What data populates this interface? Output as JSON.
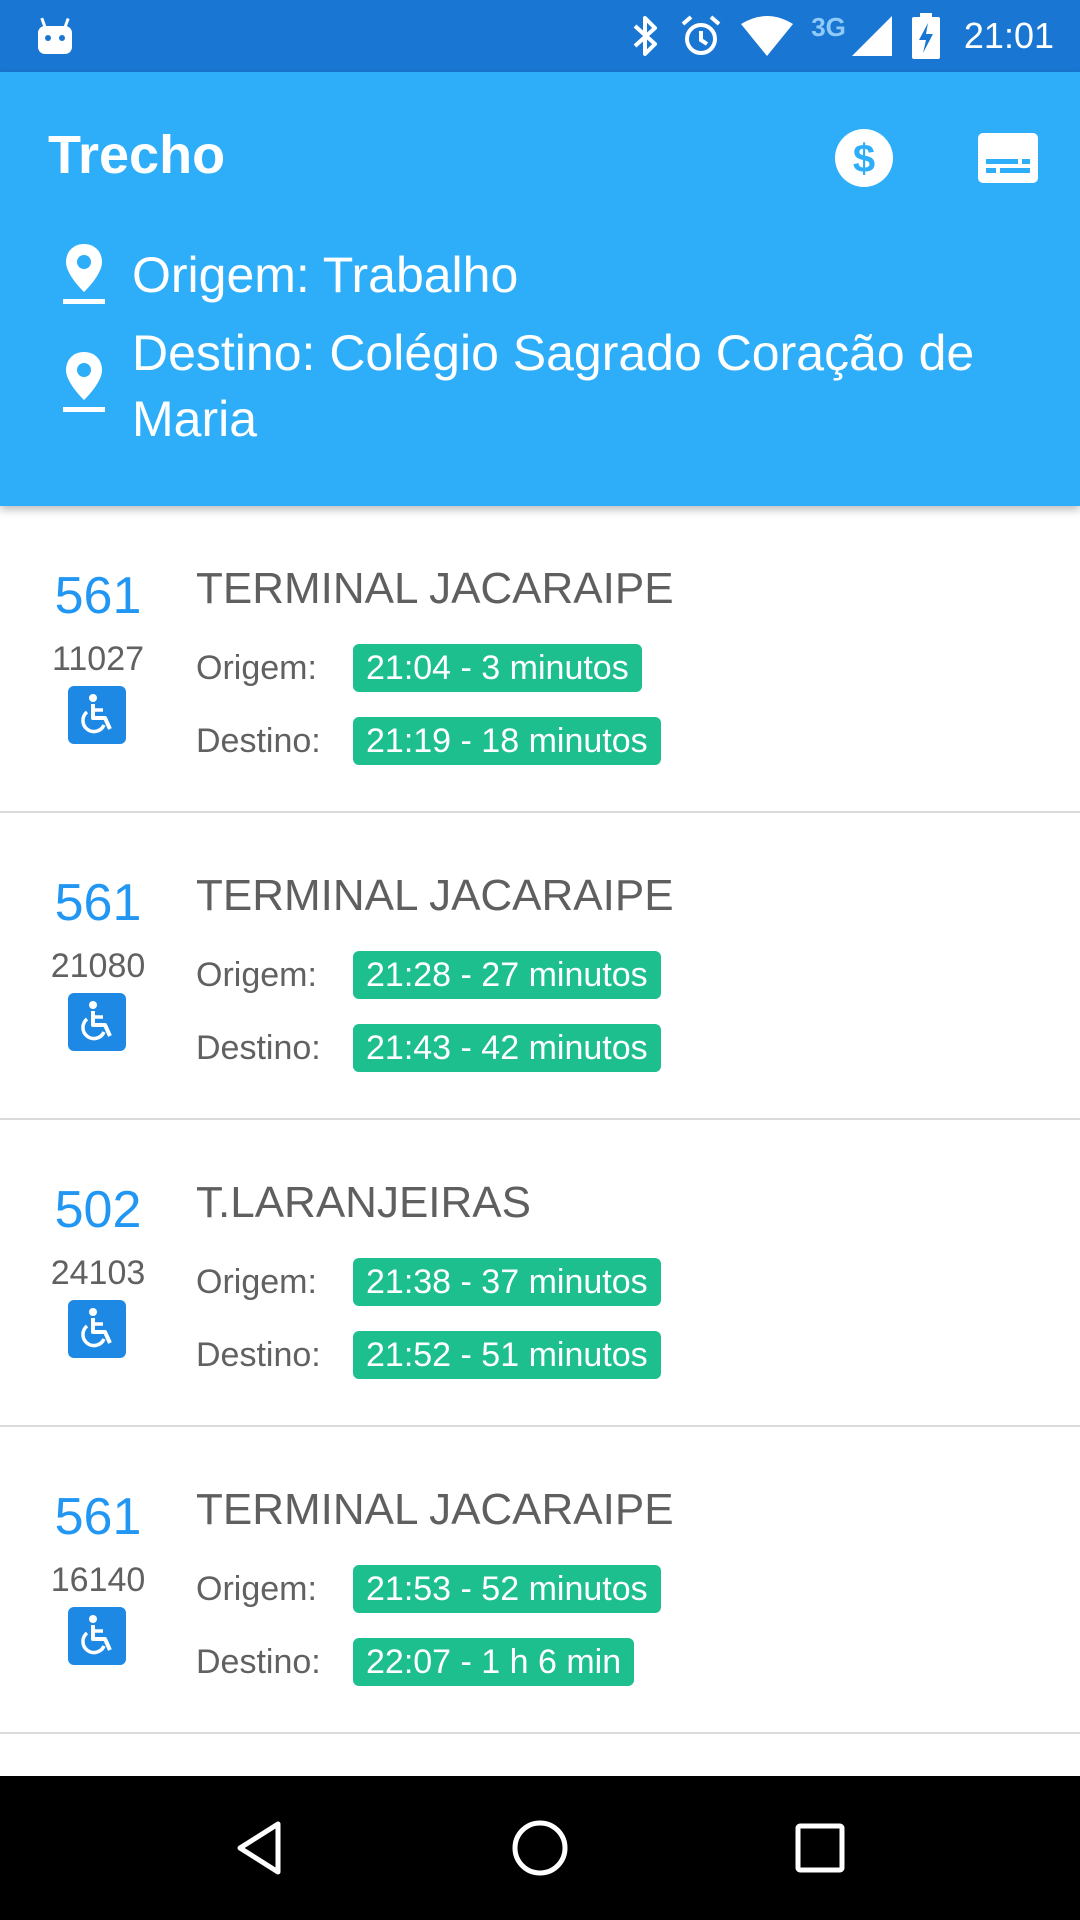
{
  "status_bar": {
    "time": "21:01",
    "network": "3G",
    "icons": [
      "android-icon",
      "bluetooth-icon",
      "alarm-icon",
      "wifi-icon",
      "signal-icon",
      "battery-charging-icon"
    ]
  },
  "app_bar": {
    "title": "Trecho",
    "actions": [
      "fare-dollar-icon",
      "card-icon"
    ],
    "origin": "Origem: Trabalho",
    "destination": "Destino: Colégio Sagrado Coração de Maria"
  },
  "trips": [
    {
      "line": "561",
      "vehicle": "11027",
      "destination": "TERMINAL JACARAIPE",
      "origin_label": "Origem:",
      "origin_time": "21:04 - 3 minutos",
      "dest_label": "Destino:",
      "dest_time": "21:19 - 18 minutos"
    },
    {
      "line": "561",
      "vehicle": "21080",
      "destination": "TERMINAL JACARAIPE",
      "origin_label": "Origem:",
      "origin_time": "21:28 - 27 minutos",
      "dest_label": "Destino:",
      "dest_time": "21:43 - 42 minutos"
    },
    {
      "line": "502",
      "vehicle": "24103",
      "destination": "T.LARANJEIRAS",
      "origin_label": "Origem:",
      "origin_time": "21:38 - 37 minutos",
      "dest_label": "Destino:",
      "dest_time": "21:52 - 51 minutos"
    },
    {
      "line": "561",
      "vehicle": "16140",
      "destination": "TERMINAL JACARAIPE",
      "origin_label": "Origem:",
      "origin_time": "21:53 - 52 minutos",
      "dest_label": "Destino:",
      "dest_time": "22:07 - 1 h 6 min"
    }
  ],
  "colors": {
    "status_bar": "#1976D2",
    "app_bar": "#2EAEF9",
    "line_number": "#2196F3",
    "time_badge": "#1DBF8E",
    "accessibility_badge": "#1E88E5"
  },
  "nav_bar": [
    "back-icon",
    "home-icon",
    "recents-icon"
  ]
}
